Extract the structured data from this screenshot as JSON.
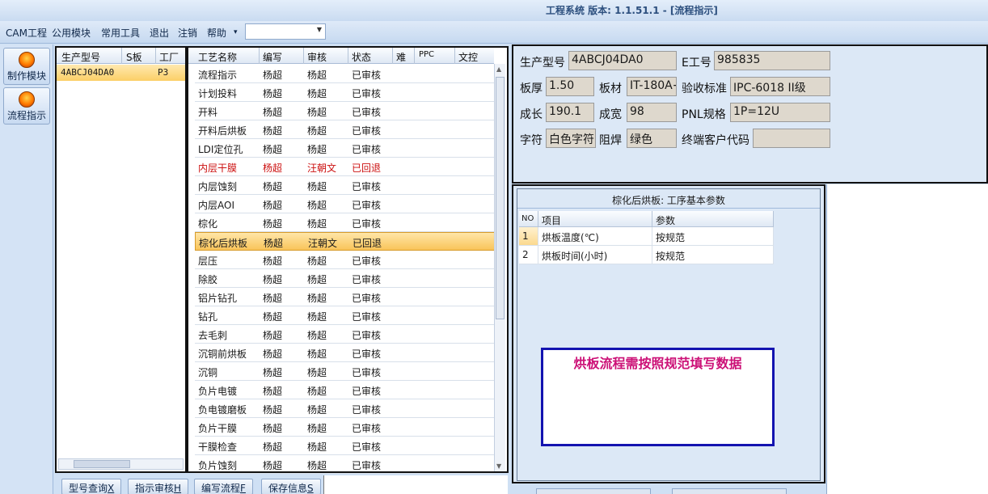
{
  "title": "工程系统   版本: 1.1.51.1 - [流程指示]",
  "menu": [
    "CAM工程",
    "公用模块",
    "常用工具",
    "退出",
    "注销",
    "帮助",
    "▾"
  ],
  "left_toolbar": [
    {
      "label": "制作模块",
      "icon": "fire-icon"
    },
    {
      "label": "流程指示",
      "icon": "flow-icon"
    }
  ],
  "product_list": {
    "headers": [
      "生产型号",
      "S板",
      "工厂"
    ],
    "rows": [
      {
        "model": "4ABCJ04DA0",
        "s": "",
        "factory": "P3"
      }
    ]
  },
  "process_grid": {
    "headers": [
      "工艺名称",
      "编写",
      "审核",
      "状态",
      "难",
      "PPC",
      "文控"
    ],
    "rows": [
      {
        "name": "流程指示",
        "writer": "杨超",
        "reviewer": "杨超",
        "status": "已审核"
      },
      {
        "name": "计划投料",
        "writer": "杨超",
        "reviewer": "杨超",
        "status": "已审核"
      },
      {
        "name": "开料",
        "writer": "杨超",
        "reviewer": "杨超",
        "status": "已审核"
      },
      {
        "name": "开料后烘板",
        "writer": "杨超",
        "reviewer": "杨超",
        "status": "已审核"
      },
      {
        "name": "LDI定位孔",
        "writer": "杨超",
        "reviewer": "杨超",
        "status": "已审核"
      },
      {
        "name": "内层干膜",
        "writer": "杨超",
        "reviewer": "汪朝文",
        "status": "已回退"
      },
      {
        "name": "内层蚀刻",
        "writer": "杨超",
        "reviewer": "杨超",
        "status": "已审核"
      },
      {
        "name": "内层AOI",
        "writer": "杨超",
        "reviewer": "杨超",
        "status": "已审核"
      },
      {
        "name": "棕化",
        "writer": "杨超",
        "reviewer": "杨超",
        "status": "已审核"
      },
      {
        "name": "棕化后烘板",
        "writer": "杨超",
        "reviewer": "汪朝文",
        "status": "已回退"
      },
      {
        "name": "层压",
        "writer": "杨超",
        "reviewer": "杨超",
        "status": "已审核"
      },
      {
        "name": "除胶",
        "writer": "杨超",
        "reviewer": "杨超",
        "status": "已审核"
      },
      {
        "name": "铝片钻孔",
        "writer": "杨超",
        "reviewer": "杨超",
        "status": "已审核"
      },
      {
        "name": "钻孔",
        "writer": "杨超",
        "reviewer": "杨超",
        "status": "已审核"
      },
      {
        "name": "去毛刺",
        "writer": "杨超",
        "reviewer": "杨超",
        "status": "已审核"
      },
      {
        "name": "沉铜前烘板",
        "writer": "杨超",
        "reviewer": "杨超",
        "status": "已审核"
      },
      {
        "name": "沉铜",
        "writer": "杨超",
        "reviewer": "杨超",
        "status": "已审核"
      },
      {
        "name": "负片电镀",
        "writer": "杨超",
        "reviewer": "杨超",
        "status": "已审核"
      },
      {
        "name": "负电镀磨板",
        "writer": "杨超",
        "reviewer": "杨超",
        "status": "已审核"
      },
      {
        "name": "负片干膜",
        "writer": "杨超",
        "reviewer": "杨超",
        "status": "已审核"
      },
      {
        "name": "干膜检查",
        "writer": "杨超",
        "reviewer": "杨超",
        "status": "已审核"
      },
      {
        "name": "负片蚀刻",
        "writer": "杨超",
        "reviewer": "杨超",
        "status": "已审核"
      }
    ]
  },
  "bottom_buttons": [
    {
      "label": "型号查询",
      "key": "X"
    },
    {
      "label": "指示审核",
      "key": "H"
    },
    {
      "label": "编写流程",
      "key": "F"
    },
    {
      "label": "保存信息",
      "key": "S"
    }
  ],
  "info": {
    "model_label": "生产型号",
    "model": "4ABCJ04DA0",
    "e_label": "E工号",
    "e_no": "985835",
    "thick_label": "板厚",
    "thickness": "1.50",
    "material_label": "板材",
    "material": "IT-180A+",
    "std_label": "验收标准",
    "standard": "IPC-6018 II级",
    "len_label": "成长",
    "length": "190.1",
    "wid_label": "成宽",
    "width": "98",
    "pnl_label": "PNL规格",
    "pnl": "1P=12U",
    "char_label": "字符",
    "character": "白色字符",
    "mask_label": "阻焊",
    "solder_mask": "绿色",
    "cust_label": "终端客户代码",
    "customer_code": ""
  },
  "params": {
    "title": "棕化后烘板: 工序基本参数",
    "headers": [
      "NO",
      "项目",
      "参数"
    ],
    "rows": [
      {
        "no": "1",
        "item": "烘板温度(℃)",
        "value": "按规范"
      },
      {
        "no": "2",
        "item": "烘板时间(小时)",
        "value": "按规范"
      }
    ]
  },
  "note": "烘板流程需按照规范填写数据"
}
